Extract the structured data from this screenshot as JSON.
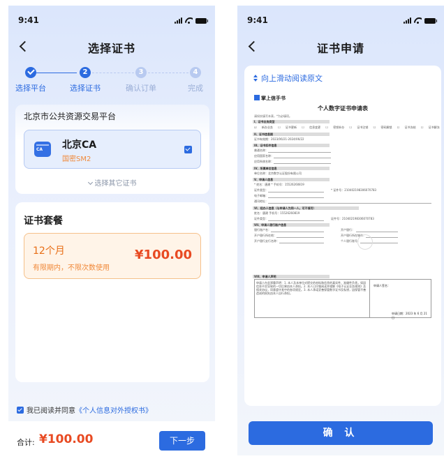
{
  "left": {
    "status_time": "9:41",
    "title": "选择证书",
    "steps": [
      {
        "num": "1",
        "label": "选择平台",
        "state": "done"
      },
      {
        "num": "2",
        "label": "选择证书",
        "state": "active"
      },
      {
        "num": "3",
        "label": "确认订单",
        "state": "pending"
      },
      {
        "num": "4",
        "label": "完成",
        "state": "pending"
      }
    ],
    "platform": {
      "title": "北京市公共资源交易平台",
      "ca_name": "北京CA",
      "ca_sub": "国密SM2",
      "ca_selected": true,
      "other_link": "选择其它证书"
    },
    "package": {
      "title": "证书套餐",
      "plan_name": "12个月",
      "plan_desc": "有限期内，不限次数使用",
      "plan_price": "¥100.00"
    },
    "agreement": {
      "checked": true,
      "prefix": "我已阅读并同意",
      "link": "《个人信息对外授权书》"
    },
    "bottom": {
      "total_label": "合计:",
      "total_value": "¥100.00",
      "next_label": "下一步"
    }
  },
  "right": {
    "status_time": "9:41",
    "title": "证书申请",
    "scroll_tip": "向上滑动阅读原文",
    "document": {
      "brand": "掌上信手书",
      "title": "个人数字证书申请表",
      "note": "请如实填写本表，*为必填项。",
      "sec1": "I、证书业务类型",
      "options": "☑ 新办业务 ☐ 证书更新 ☐ 信息变更 ☐ 密钥补办 ☐ 证书注销 ☐ 密码解锁 ☐ 证书冻结 ☐ 证书解冻",
      "sec2": "II、证书信息期",
      "validity": "证书有效期：2023/06/21-2024/06/22",
      "sec3": "III、证书扣件信息",
      "l3a": "普通名称：",
      "l3b": "应用国家名称：",
      "l3c": "应用系统名称：",
      "sec4": "IV、所属单位信息",
      "unit": "单位名称：北京数字认证股份有限公司",
      "sec5": "V、申请人信息",
      "applicant": "* 姓名：唐建   * 手机号：15526260819",
      "id_type": "证件类型：",
      "id_no": "* 证件号：210402198306070783",
      "email": "电子邮箱：",
      "addr": "通讯地址：",
      "sec6": "VI、经办人信息（与申请人为同一人，可不填写）",
      "agent": "姓名：唐建   手机号：15526260819",
      "agent_id": "证件类型：",
      "agent_no": "证件号：210402198306070783",
      "sec7": "VII、申请人银行账户信息",
      "bank1": "银行账户名：",
      "bank2": "开户银行所在地：",
      "bank3": "开户银行支行名称：",
      "bank1r": "开户银行：",
      "bank2r": "开户银行所在城市：",
      "bank3r": "个人银行账号：",
      "sec8": "VIII、申请人声明",
      "declare": "申请人在此郑重声明：1. 本人及本单位对提交的材料和信息的真实性、准确性负责，如因信息不实导致的一切后果由本人承担。2. 本人已仔细阅读并理解《电子认证业务规则》及相关协议，同意遵守其中的各项规定。3. 本人承诺妥善保管数字证书及私钥，因保管不善造成的损失由本人自行承担。",
      "sig_label": "申请人签名：",
      "date_label": "申请日期：2023 年 6 月 21 日"
    },
    "confirm_label": "确 认"
  },
  "colors": {
    "primary": "#2c6be0",
    "accent_orange": "#e86e16",
    "price_red": "#e84a22",
    "pending_step": "#b8caf0"
  },
  "icons": [
    "back-chevron-icon",
    "signal-icon",
    "wifi-icon",
    "battery-icon",
    "check-icon",
    "ca-certificate-icon",
    "chevron-down-icon",
    "scroll-updown-icon"
  ]
}
